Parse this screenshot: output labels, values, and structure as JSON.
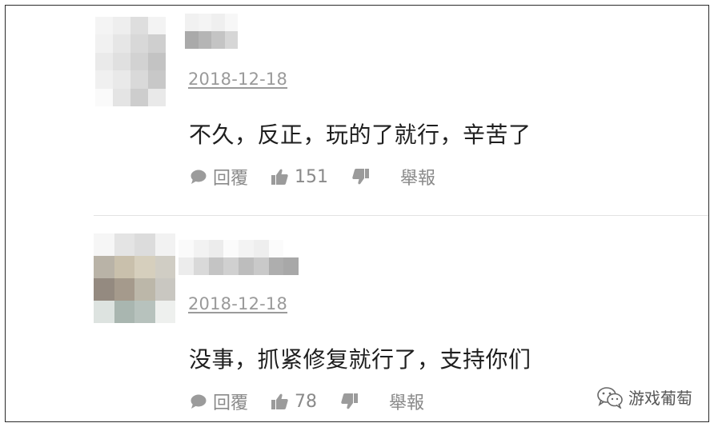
{
  "comments": [
    {
      "date": "2018-12-18",
      "text": "不久，反正，玩的了就行，辛苦了",
      "reply_label": "回覆",
      "like_count": "151",
      "report_label": "舉報"
    },
    {
      "date": "2018-12-18",
      "text": "没事，抓紧修复就行了，支持你们",
      "reply_label": "回覆",
      "like_count": "78",
      "report_label": "舉報"
    }
  ],
  "watermark": {
    "text": "游戏葡萄",
    "icon": "wechat-icon"
  },
  "colors": {
    "meta_gray": "#9a9a9a",
    "text": "#1e1e1e",
    "icon_gray": "#9b9b9b"
  }
}
